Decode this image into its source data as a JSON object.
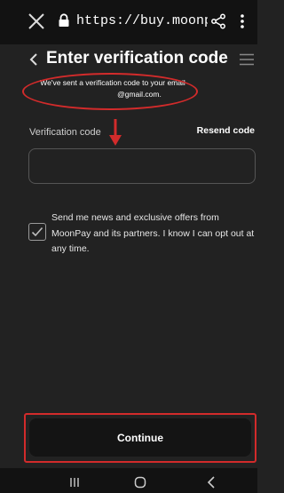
{
  "browser": {
    "url": "https://buy.moonpay...",
    "icons": {
      "close": "close-icon",
      "lock": "lock-icon",
      "share": "share-icon",
      "menu": "more-vertical-icon"
    }
  },
  "header": {
    "title": "Enter verification code",
    "icons": {
      "back": "chevron-left-icon",
      "menu": "hamburger-menu-icon"
    }
  },
  "subtitle": {
    "line1": "We've sent a verification code to your email",
    "line2": "@gmail.com."
  },
  "form": {
    "code_label": "Verification code",
    "resend_label": "Resend code",
    "code_value": "",
    "code_placeholder": "",
    "consent_checked": true,
    "consent_text": "Send me news and exclusive offers from MoonPay and its partners. I know I can opt out at any time."
  },
  "actions": {
    "continue_label": "Continue"
  },
  "annotations": {
    "color": "#d22b2b"
  },
  "colors": {
    "background": "#222222",
    "bar": "#121212",
    "button": "#141414"
  },
  "system_nav": {
    "icons": [
      "recent-apps-icon",
      "home-icon",
      "back-icon"
    ]
  }
}
